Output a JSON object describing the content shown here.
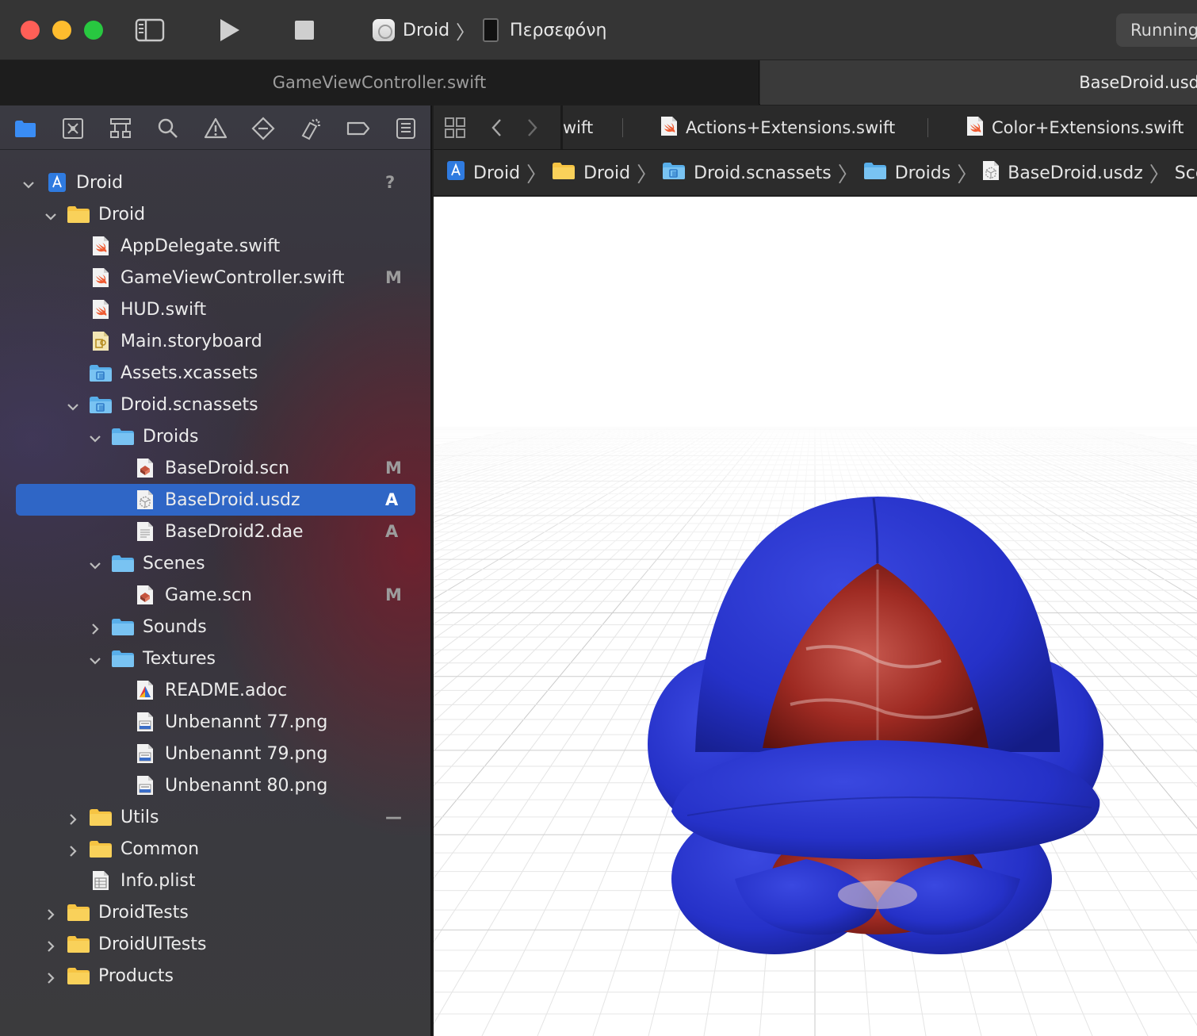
{
  "window": {
    "traffic_lights": [
      "#ff5f57",
      "#febc2e",
      "#28c840"
    ],
    "scheme": {
      "app": "Droid",
      "device": "Περσεφόνη"
    },
    "status": "Running",
    "window_tabs": [
      {
        "label": "GameViewController.swift",
        "active": false
      },
      {
        "label": "BaseDroid.usdz",
        "active": true
      }
    ]
  },
  "navigator": {
    "toolbar_icons": [
      "folder-icon",
      "source-control-icon",
      "hierarchy-icon",
      "search-icon",
      "warning-icon",
      "test-icon",
      "debug-icon",
      "breakpoint-icon",
      "report-icon"
    ],
    "items": [
      {
        "label": "Droid",
        "kind": "project",
        "depth": 0,
        "chevron": "down",
        "badge": "?"
      },
      {
        "label": "Droid",
        "kind": "folder",
        "depth": 1,
        "chevron": "down",
        "badge": ""
      },
      {
        "label": "AppDelegate.swift",
        "kind": "swift",
        "depth": 2,
        "chevron": "",
        "badge": ""
      },
      {
        "label": "GameViewController.swift",
        "kind": "swift",
        "depth": 2,
        "chevron": "",
        "badge": "M"
      },
      {
        "label": "HUD.swift",
        "kind": "swift",
        "depth": 2,
        "chevron": "",
        "badge": ""
      },
      {
        "label": "Main.storyboard",
        "kind": "storyboard",
        "depth": 2,
        "chevron": "",
        "badge": ""
      },
      {
        "label": "Assets.xcassets",
        "kind": "assets",
        "depth": 2,
        "chevron": "",
        "badge": ""
      },
      {
        "label": "Droid.scnassets",
        "kind": "assets",
        "depth": 2,
        "chevron": "down",
        "badge": ""
      },
      {
        "label": "Droids",
        "kind": "bluefolder",
        "depth": 3,
        "chevron": "down",
        "badge": ""
      },
      {
        "label": "BaseDroid.scn",
        "kind": "scn",
        "depth": 4,
        "chevron": "",
        "badge": "M"
      },
      {
        "label": "BaseDroid.usdz",
        "kind": "usdz",
        "depth": 4,
        "chevron": "",
        "badge": "A",
        "selected": true
      },
      {
        "label": "BaseDroid2.dae",
        "kind": "doc",
        "depth": 4,
        "chevron": "",
        "badge": "A"
      },
      {
        "label": "Scenes",
        "kind": "bluefolder",
        "depth": 3,
        "chevron": "down",
        "badge": ""
      },
      {
        "label": "Game.scn",
        "kind": "scn",
        "depth": 4,
        "chevron": "",
        "badge": "M"
      },
      {
        "label": "Sounds",
        "kind": "bluefolder",
        "depth": 3,
        "chevron": "right",
        "badge": ""
      },
      {
        "label": "Textures",
        "kind": "bluefolder",
        "depth": 3,
        "chevron": "down",
        "badge": ""
      },
      {
        "label": "README.adoc",
        "kind": "adoc",
        "depth": 4,
        "chevron": "",
        "badge": ""
      },
      {
        "label": "Unbenannt 77.png",
        "kind": "png",
        "depth": 4,
        "chevron": "",
        "badge": ""
      },
      {
        "label": "Unbenannt 79.png",
        "kind": "png",
        "depth": 4,
        "chevron": "",
        "badge": ""
      },
      {
        "label": "Unbenannt 80.png",
        "kind": "png",
        "depth": 4,
        "chevron": "",
        "badge": ""
      },
      {
        "label": "Utils",
        "kind": "folder",
        "depth": 2,
        "chevron": "right",
        "badge": "—"
      },
      {
        "label": "Common",
        "kind": "folder",
        "depth": 2,
        "chevron": "right",
        "badge": ""
      },
      {
        "label": "Info.plist",
        "kind": "plist",
        "depth": 2,
        "chevron": "",
        "badge": ""
      },
      {
        "label": "DroidTests",
        "kind": "folder",
        "depth": 1,
        "chevron": "right",
        "badge": ""
      },
      {
        "label": "DroidUITests",
        "kind": "folder",
        "depth": 1,
        "chevron": "right",
        "badge": ""
      },
      {
        "label": "Products",
        "kind": "folder",
        "depth": 1,
        "chevron": "right",
        "badge": ""
      }
    ]
  },
  "editor": {
    "tabs": [
      {
        "label": "wift"
      },
      {
        "label": "Actions+Extensions.swift"
      },
      {
        "label": "Color+Extensions.swift"
      }
    ],
    "jumpbar": [
      {
        "label": "Droid",
        "kind": "project"
      },
      {
        "label": "Droid",
        "kind": "folder"
      },
      {
        "label": "Droid.scnassets",
        "kind": "assets"
      },
      {
        "label": "Droids",
        "kind": "bluefolder"
      },
      {
        "label": "BaseDroid.usdz",
        "kind": "usdz"
      },
      {
        "label": "Scene graph",
        "kind": ""
      }
    ],
    "model_colors": {
      "shell": "#2531c8",
      "core": "#9e2a22"
    }
  }
}
